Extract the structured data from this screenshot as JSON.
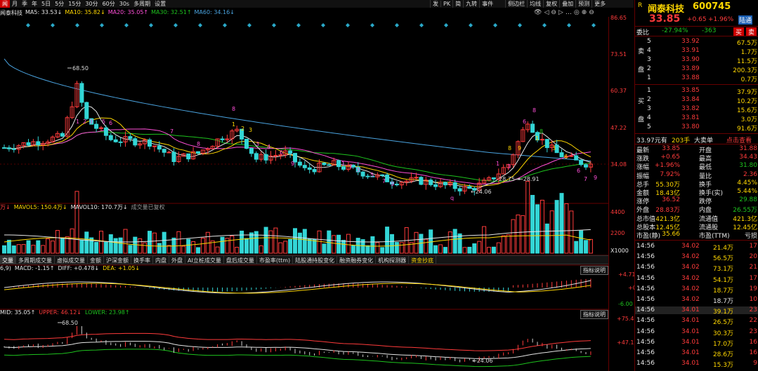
{
  "toolbar": {
    "periods": [
      "闻",
      "月",
      "季",
      "年",
      "5日",
      "5分",
      "15分",
      "30分",
      "60分",
      "30s",
      "多周期",
      "设置"
    ],
    "right": [
      "发",
      "PK",
      "简",
      "九转",
      "事件",
      "",
      "",
      "侧边栏",
      "均线",
      "复权",
      "叠加",
      "预测",
      "更多",
      "",
      ""
    ]
  },
  "ma_legend": {
    "name": "闻泰科技",
    "ma5": "MA5: 33.53↓",
    "ma10": "MA10: 35.82↓",
    "ma20": "MA20: 35.05↑",
    "ma30": "MA30: 32.51↑",
    "ma60": "MA60: 34.16↓"
  },
  "colors": {
    "up": "#ff3b3b",
    "down": "#33d6d6",
    "ma5": "#e6e6e6",
    "ma10": "#ffd700",
    "ma20": "#ff4fd8",
    "ma30": "#1ec31e",
    "ma60": "#4aa3df"
  },
  "price_axis": [
    "86.65",
    "73.51",
    "60.37",
    "47.22",
    "34.08"
  ],
  "price_annotations": {
    "high": "68.50",
    "low": "24.06",
    "mid_a": "28.75",
    "mid_b": "28.91",
    "q_mark": "q",
    "l_mark": "L"
  },
  "volume_legend": {
    "a": "万↓",
    "mavol5": "MAVOL5: 150.4万↓",
    "mavol10": "MAVOL10: 170.7万↓",
    "note": "成交量已复权"
  },
  "volume_axis": [
    "4400",
    "2200",
    "X1000"
  ],
  "tabs": [
    "交量",
    "多周期成交量",
    "虚拟成交量",
    "金额",
    "沪深金额",
    "换手率",
    "内盘",
    "外盘",
    "AI立桩成交量",
    "盘后成交量",
    "市盈率(ttm)",
    "陆股通持股变化",
    "融资融券变化",
    "机构探测器",
    "资金抄底"
  ],
  "macd_legend": {
    "prefix": "6,9)",
    "macd": "MACD: -1.15↑",
    "diff": "DIFF: +0.478↓",
    "dea": "DEA: +1.05↓"
  },
  "macd_axis": [
    "+4.71",
    "+0",
    "-6.00"
  ],
  "boll_legend": {
    "mid": "MID: 35.05↑",
    "upper": "UPPER: 46.12↓",
    "lower": "LOWER: 23.98↑"
  },
  "boll_axis": [
    "+75.41",
    "+47.13"
  ],
  "boll_annotations": {
    "high": "68.50",
    "low": "24.06"
  },
  "help_label": "指标说明",
  "quote": {
    "flag": "R",
    "name": "闻泰科技",
    "code": "600745",
    "price": "33.85",
    "change": "+0.65",
    "pct": "+1.96%",
    "badge": "陆通",
    "weibi_label": "委比",
    "weibi": "-27.94%",
    "weicha": "-363",
    "buy": "买",
    "sell": "卖",
    "sell_levels": [
      {
        "lv": "5",
        "p": "33.92",
        "v": "67.5万"
      },
      {
        "lv": "4",
        "p": "33.91",
        "v": "1.7万"
      },
      {
        "lv": "3",
        "p": "33.90",
        "v": "11.5万"
      },
      {
        "lv": "2",
        "p": "33.89",
        "v": "200.3万"
      },
      {
        "lv": "1",
        "p": "33.88",
        "v": "0.7万"
      }
    ],
    "buy_levels": [
      {
        "lv": "1",
        "p": "33.85",
        "v": "37.9万"
      },
      {
        "lv": "2",
        "p": "33.84",
        "v": "10.2万"
      },
      {
        "lv": "3",
        "p": "33.82",
        "v": "15.6万"
      },
      {
        "lv": "4",
        "p": "33.81",
        "v": "3.0万"
      },
      {
        "lv": "5",
        "p": "33.80",
        "v": "91.6万"
      }
    ],
    "sell_side": [
      "卖",
      "盘"
    ],
    "buy_side": [
      "买",
      "盘"
    ],
    "big": {
      "p": "33.97元有",
      "h": "203手",
      "label": "大卖单",
      "link": "点击查看"
    },
    "stats": [
      [
        "最新",
        "33.85",
        "开盘",
        "31.88"
      ],
      [
        "涨跌",
        "+0.65",
        "最高",
        "34.43"
      ],
      [
        "涨幅",
        "+1.96%",
        "最低",
        "31.80"
      ],
      [
        "振幅",
        "7.92%",
        "量比",
        "2.36"
      ],
      [
        "总手",
        "55.30万",
        "换手",
        "4.45%"
      ],
      [
        "金额",
        "18.43亿",
        "换手(实)",
        "5.44%"
      ],
      [
        "涨停",
        "36.52",
        "跌停",
        "29.88"
      ],
      [
        "外盘",
        "28.83万",
        "内盘",
        "26.55万"
      ],
      [
        "总市值",
        "421.3亿",
        "流通值",
        "421.3亿"
      ],
      [
        "总股本",
        "12.45亿",
        "流通股",
        "12.45亿"
      ],
      [
        "市盈(静)",
        "35.66",
        "市盈(TTM)",
        "亏损"
      ]
    ],
    "ticks": [
      [
        "14:56",
        "34.02",
        "21.4万",
        "17"
      ],
      [
        "14:56",
        "34.02",
        "56.5万",
        "20"
      ],
      [
        "14:56",
        "34.02",
        "73.1万",
        "21"
      ],
      [
        "14:56",
        "34.02",
        "54.1万",
        "17"
      ],
      [
        "14:56",
        "34.02",
        "18.7万",
        "19"
      ],
      [
        "14:56",
        "34.02",
        "18.7万",
        "10"
      ],
      [
        "14:56",
        "34.01",
        "39.1万",
        "23"
      ],
      [
        "14:56",
        "34.01",
        "26.5万",
        "22"
      ],
      [
        "14:56",
        "34.01",
        "30.3万",
        "23"
      ],
      [
        "14:56",
        "34.01",
        "17.0万",
        "16"
      ],
      [
        "14:56",
        "34.01",
        "28.6万",
        "16"
      ],
      [
        "14:56",
        "34.01",
        "15.3万",
        "9"
      ]
    ]
  }
}
